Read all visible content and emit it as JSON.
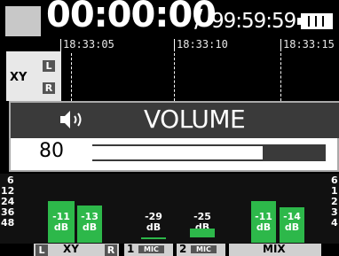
{
  "header": {
    "elapsed": "00:00:00",
    "separator": "/",
    "remaining": "99:59:59"
  },
  "timeline": {
    "marks": [
      "18:33:05",
      "18:33:10",
      "18:33:15"
    ]
  },
  "track": {
    "name": "XY",
    "badge_l": "L",
    "badge_r": "R"
  },
  "volume": {
    "title": "VOLUME",
    "value": "80",
    "level_fraction": 0.73
  },
  "meters": {
    "scale": [
      "6",
      "12",
      "24",
      "36",
      "48"
    ],
    "scale_right": [
      "6",
      "1",
      "2",
      "3",
      "4"
    ],
    "xy_l": {
      "value": "-11",
      "unit": "dB",
      "level": 0.62
    },
    "xy_r": {
      "value": "-13",
      "unit": "dB",
      "level": 0.55
    },
    "ch1": {
      "value": "-29",
      "unit": "dB",
      "level": 0.0
    },
    "ch2": {
      "value": "-25",
      "unit": "dB",
      "level": 0.0
    },
    "mix_l": {
      "value": "-11",
      "unit": "dB",
      "level": 0.62
    },
    "mix_r": {
      "value": "-14",
      "unit": "dB",
      "level": 0.52
    }
  },
  "channels": {
    "xy": "XY",
    "l": "L",
    "r": "R",
    "ch1_num": "1",
    "ch1_src": "MIC",
    "ch2_num": "2",
    "ch2_src": "MIC",
    "mix": "MIX"
  },
  "colors": {
    "meter_green": "#2db84a",
    "panel_dark": "#3a3a3a"
  }
}
